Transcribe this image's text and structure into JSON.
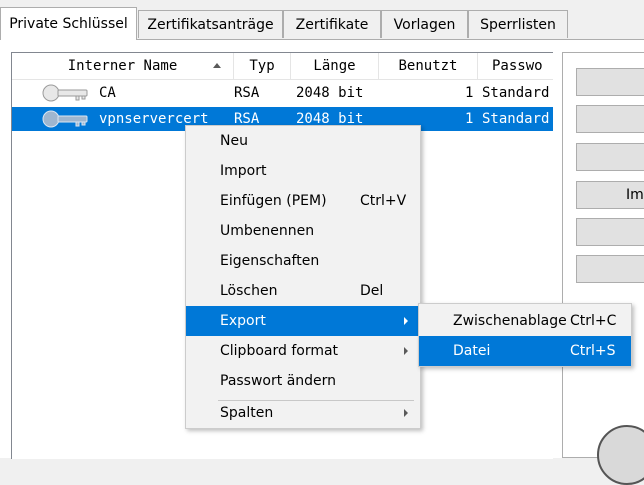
{
  "tabs": [
    {
      "label": "Private Schlüssel",
      "active": true
    },
    {
      "label": "Zertifikatsanträge"
    },
    {
      "label": "Zertifikate"
    },
    {
      "label": "Vorlagen"
    },
    {
      "label": "Sperrlisten"
    }
  ],
  "table": {
    "columns": [
      "Interner Name",
      "Typ",
      "Länge",
      "Benutzt",
      "Passwo"
    ],
    "rows": [
      {
        "name": "CA",
        "typ": "RSA",
        "laenge": "2048 bit",
        "benutzt": "1",
        "passwort": "Standard",
        "selected": false
      },
      {
        "name": "vpnservercert",
        "typ": "RSA",
        "laenge": "2048 bit",
        "benutzt": "1",
        "passwort": "Standard",
        "selected": true
      }
    ]
  },
  "right_buttons": [
    "",
    "",
    "",
    "Im",
    "",
    ""
  ],
  "context_menu": {
    "items": [
      {
        "label": "Neu",
        "shortcut": ""
      },
      {
        "label": "Import",
        "shortcut": ""
      },
      {
        "label": "Einfügen (PEM)",
        "shortcut": "Ctrl+V"
      },
      {
        "label": "Umbenennen",
        "shortcut": ""
      },
      {
        "label": "Eigenschaften",
        "shortcut": ""
      },
      {
        "label": "Löschen",
        "shortcut": "Del"
      },
      {
        "label": "Export",
        "shortcut": "",
        "submenu": true,
        "highlighted": true
      },
      {
        "label": "Clipboard format",
        "shortcut": "",
        "submenu": true
      },
      {
        "label": "Passwort ändern",
        "shortcut": ""
      },
      {
        "label": "Spalten",
        "shortcut": "",
        "submenu": true
      }
    ]
  },
  "export_submenu": {
    "items": [
      {
        "label": "Zwischenablage",
        "shortcut": "Ctrl+C"
      },
      {
        "label": "Datei",
        "shortcut": "Ctrl+S",
        "highlighted": true
      }
    ]
  },
  "colors": {
    "selection": "#0078d7",
    "menu_bg": "#f2f2f2",
    "window_bg": "#f0f0f0"
  }
}
